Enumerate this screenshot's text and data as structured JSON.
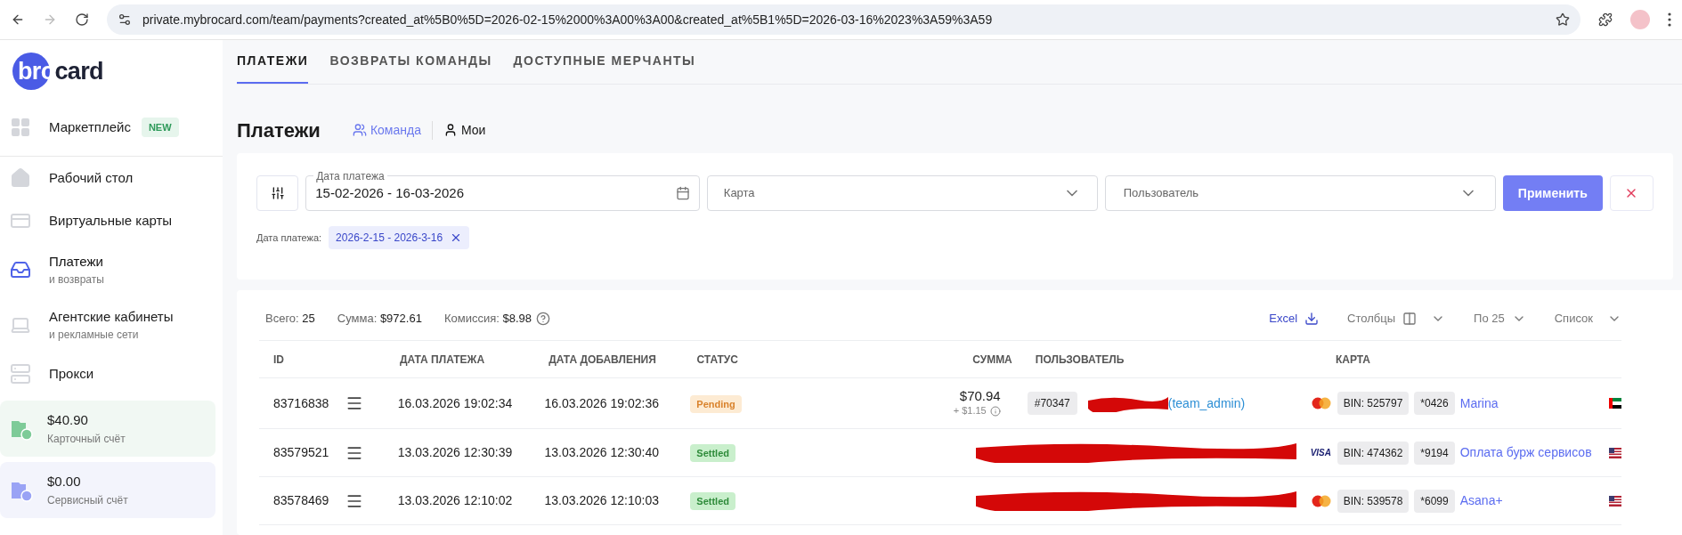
{
  "browser": {
    "url": "private.mybrocard.com/team/payments?created_at%5B0%5D=2026-02-15%2000%3A00%3A00&created_at%5B1%5D=2026-03-16%2023%3A59%3A59"
  },
  "sidebar": {
    "logo": {
      "part_1": "bro",
      "part_2": "card"
    },
    "items": [
      {
        "kind": "grid",
        "label": "Маркетплейс",
        "badge": "NEW",
        "selected": false
      },
      {
        "kind": "home",
        "label": "Рабочий стол",
        "selected": false
      },
      {
        "kind": "card",
        "label": "Виртуальные карты",
        "selected": false
      },
      {
        "kind": "inbox",
        "label": "Платежи",
        "sublabel": "и возвраты",
        "selected": true
      },
      {
        "kind": "laptop",
        "label": "Агентские кабинеты",
        "sublabel": "и рекламные сети",
        "selected": false
      },
      {
        "kind": "server",
        "label": "Прокси",
        "selected": false
      }
    ],
    "accounts": [
      {
        "kind": "card",
        "amount": "$40.90",
        "label": "Карточный счёт"
      },
      {
        "kind": "service",
        "amount": "$0.00",
        "label": "Сервисный счёт"
      }
    ]
  },
  "tabs": [
    {
      "label": "ПЛАТЕЖИ",
      "selected": true
    },
    {
      "label": "ВОЗВРАТЫ КОМАНДЫ",
      "selected": false
    },
    {
      "label": "ДОСТУПНЫЕ МЕРЧАНТЫ",
      "selected": false
    }
  ],
  "page": {
    "title": "Платежи",
    "scopes": [
      {
        "kind": "team",
        "label": "Команда",
        "selected": true
      },
      {
        "kind": "me",
        "label": "Мои",
        "selected": false
      }
    ]
  },
  "filters": {
    "date_field": {
      "label": "Дата платежа",
      "value": "15-02-2026 - 16-03-2026"
    },
    "card_field": {
      "placeholder": "Карта"
    },
    "user_field": {
      "placeholder": "Пользователь"
    },
    "apply_button": "Применить",
    "chip": {
      "label": "Дата платежа:",
      "value": "2026-2-15 - 2026-3-16"
    }
  },
  "summary": [
    {
      "label": "Всего:",
      "value": "25"
    },
    {
      "label": "Сумма:",
      "value": "$972.61"
    },
    {
      "label": "Комиссия:",
      "value": "$8.98"
    }
  ],
  "toolbar": {
    "excel": "Excel",
    "columns": "Столбцы",
    "per_page": "По 25",
    "view": "Список"
  },
  "table": {
    "columns": [
      "ID",
      "ДАТА ПЛАТЕЖА",
      "ДАТА ДОБАВЛЕНИЯ",
      "СТАТУС",
      "СУММА",
      "ПОЛЬЗОВАТЕЛЬ",
      "КАРТА"
    ],
    "rows": [
      {
        "id": "83716838",
        "payment_date": "16.03.2026 19:02:34",
        "added_date": "16.03.2026 19:02:36",
        "status": {
          "kind": "pending",
          "label": "Pending"
        },
        "kind": "redacted_name",
        "amount": "$70.94",
        "fee": "+ $1.15",
        "user_id": "#70347",
        "user_role": "(team_admin)",
        "card": {
          "kind": "mastercard",
          "bin": "BIN: 525797",
          "last4": "*0426",
          "name": "Marina"
        },
        "flag": {
          "kind": "ae"
        }
      },
      {
        "id": "83579521",
        "payment_date": "13.03.2026 12:30:39",
        "added_date": "13.03.2026 12:30:40",
        "status": {
          "kind": "settled",
          "label": "Settled"
        },
        "kind": "redacted_wide",
        "card": {
          "kind": "visa",
          "network_label": "VISA",
          "bin": "BIN: 474362",
          "last4": "*9194",
          "name": "Оплата бурж сервисов"
        },
        "flag": {
          "kind": "us"
        }
      },
      {
        "id": "83578469",
        "payment_date": "13.03.2026 12:10:02",
        "added_date": "13.03.2026 12:10:03",
        "status": {
          "kind": "settled",
          "label": "Settled"
        },
        "kind": "redacted_wide",
        "card": {
          "kind": "mastercard",
          "bin": "BIN: 539578",
          "last4": "*6099",
          "name": "Asana+"
        },
        "flag": {
          "kind": "us"
        }
      }
    ]
  }
}
